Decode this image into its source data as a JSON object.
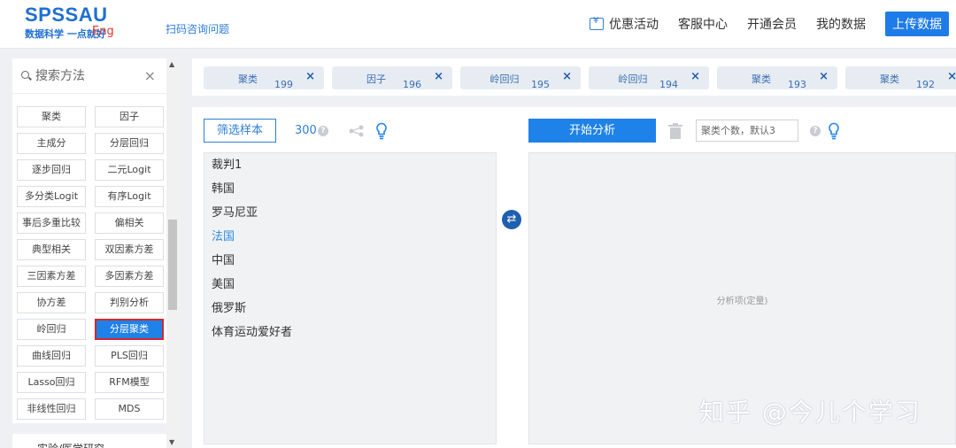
{
  "header": {
    "logo": "SPSSAU",
    "tagline": "数据科学 一点就好",
    "lang": "Eng",
    "consult_link": "扫码咨询问题",
    "nav": [
      "优惠活动",
      "客服中心",
      "开通会员",
      "我的数据"
    ],
    "upload_label": "上传数据"
  },
  "sidebar": {
    "search_placeholder": "搜索方法",
    "clear_symbol": "×",
    "methods": [
      "聚类",
      "因子",
      "主成分",
      "分层回归",
      "逐步回归",
      "二元Logit",
      "多分类Logit",
      "有序Logit",
      "事后多重比较",
      "偏相关",
      "典型相关",
      "双因素方差",
      "三因素方差",
      "多因素方差",
      "协方差",
      "判别分析",
      "岭回归",
      "分层聚类",
      "曲线回归",
      "PLS回归",
      "Lasso回归",
      "RFM模型",
      "非线性回归",
      "MDS"
    ],
    "active_method": "分层聚类",
    "bottom_label": "实验/医学研究"
  },
  "tabs": [
    {
      "label": "聚类",
      "num": "199"
    },
    {
      "label": "因子",
      "num": "196"
    },
    {
      "label": "岭回归",
      "num": "195"
    },
    {
      "label": "岭回归",
      "num": "194"
    },
    {
      "label": "聚类",
      "num": "193"
    },
    {
      "label": "聚类",
      "num": "192"
    }
  ],
  "main": {
    "filter_label": "筛选样本",
    "sample_count": "300",
    "variables": [
      "裁判1",
      "韩国",
      "罗马尼亚",
      "法国",
      "中国",
      "美国",
      "俄罗斯",
      "体育运动爱好者"
    ],
    "selected_variable": "法国",
    "start_label": "开始分析",
    "cluster_placeholder": "聚类个数，默认3",
    "drop_hint": "分析项(定量)"
  },
  "watermark": "知乎 @今儿个学习",
  "colors": {
    "brand": "#1f6fd1",
    "accent": "#1f82e8",
    "active_border": "#d9252a"
  }
}
